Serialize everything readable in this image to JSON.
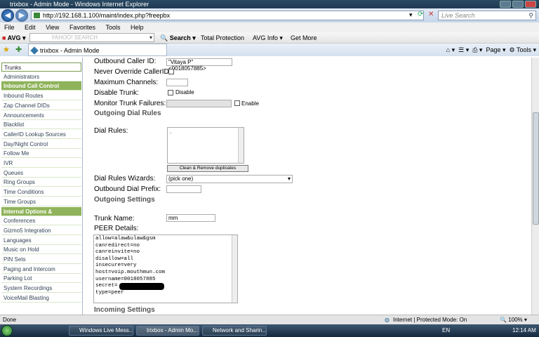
{
  "window": {
    "title": "trixbox - Admin Mode - Windows Internet Explorer"
  },
  "address": {
    "url": "http://192.168.1.100/maint/index.php?freepbx",
    "search_placeholder": "Live Search"
  },
  "menu": [
    "File",
    "Edit",
    "View",
    "Favorites",
    "Tools",
    "Help"
  ],
  "avg": {
    "logo": "AVG",
    "yahoo_placeholder": "YAHOO! SEARCH",
    "search": "Search",
    "total_protection": "Total Protection",
    "avg_info": "AVG Info",
    "get_more": "Get More"
  },
  "tab": {
    "title": "trixbox - Admin Mode",
    "page_menu": "Page",
    "tools_menu": "Tools"
  },
  "sidebar": [
    {
      "label": "Trunks",
      "type": "selected"
    },
    {
      "label": "Administrators",
      "type": "item"
    },
    {
      "label": "Inbound Call Control",
      "type": "head"
    },
    {
      "label": "Inbound Routes",
      "type": "item"
    },
    {
      "label": "Zap Channel DIDs",
      "type": "item"
    },
    {
      "label": "Announcements",
      "type": "item"
    },
    {
      "label": "Blacklist",
      "type": "item"
    },
    {
      "label": "CallerID Lookup Sources",
      "type": "item"
    },
    {
      "label": "Day/Night Control",
      "type": "item"
    },
    {
      "label": "Follow Me",
      "type": "item"
    },
    {
      "label": "IVR",
      "type": "item"
    },
    {
      "label": "Queues",
      "type": "item"
    },
    {
      "label": "Ring Groups",
      "type": "item"
    },
    {
      "label": "Time Conditions",
      "type": "item"
    },
    {
      "label": "Time Groups",
      "type": "item"
    },
    {
      "label": "Internal Options & Configuration",
      "type": "head"
    },
    {
      "label": "Conferences",
      "type": "item"
    },
    {
      "label": "Gizmo5 Integration",
      "type": "item"
    },
    {
      "label": "Languages",
      "type": "item"
    },
    {
      "label": "Music on Hold",
      "type": "item"
    },
    {
      "label": "PIN Sets",
      "type": "item"
    },
    {
      "label": "Paging and Intercom",
      "type": "item"
    },
    {
      "label": "Parking Lot",
      "type": "item"
    },
    {
      "label": "System Recordings",
      "type": "item"
    },
    {
      "label": "VoiceMail Blasting",
      "type": "item"
    }
  ],
  "form": {
    "outbound_cid_label": "Outbound Caller ID:",
    "outbound_cid_value": "\"Vitaya P\" <0018057885>",
    "never_override_label": "Never Override CallerID:",
    "max_channels_label": "Maximum Channels:",
    "disable_trunk_label": "Disable Trunk:",
    "disable_text": "Disable",
    "monitor_label": "Monitor Trunk Failures:",
    "enable_text": "Enable",
    "outgoing_dial_rules": "Outgoing Dial Rules",
    "dial_rules_label": "Dial Rules:",
    "dial_rules_value": ".",
    "clean_button": "Clean & Remove duplicates",
    "wizards_label": "Dial Rules Wizards:",
    "wizards_value": "(pick one)",
    "outbound_prefix_label": "Outbound Dial Prefix:",
    "outgoing_settings": "Outgoing Settings",
    "trunk_name_label": "Trunk Name:",
    "trunk_name_value": "mm",
    "peer_details_label": "PEER Details:",
    "peer_lines": [
      "allow=alaw&ulaw&gsm",
      "canredirect=no",
      "canreinvite=no",
      "disallow=all",
      "insecure=very",
      "host=voip.mouthmun.com",
      "username=0018057885",
      "secret=",
      "type=peer"
    ],
    "incoming_settings": "Incoming Settings"
  },
  "status": {
    "left": "Done",
    "zone": "Internet | Protected Mode: On",
    "zoom": "100%"
  },
  "taskbar": {
    "buttons": [
      "Windows Live Mess...",
      "trixbox - Admin Mo...",
      "Network and Sharin..."
    ],
    "lang": "EN",
    "time": "12:14 AM"
  }
}
